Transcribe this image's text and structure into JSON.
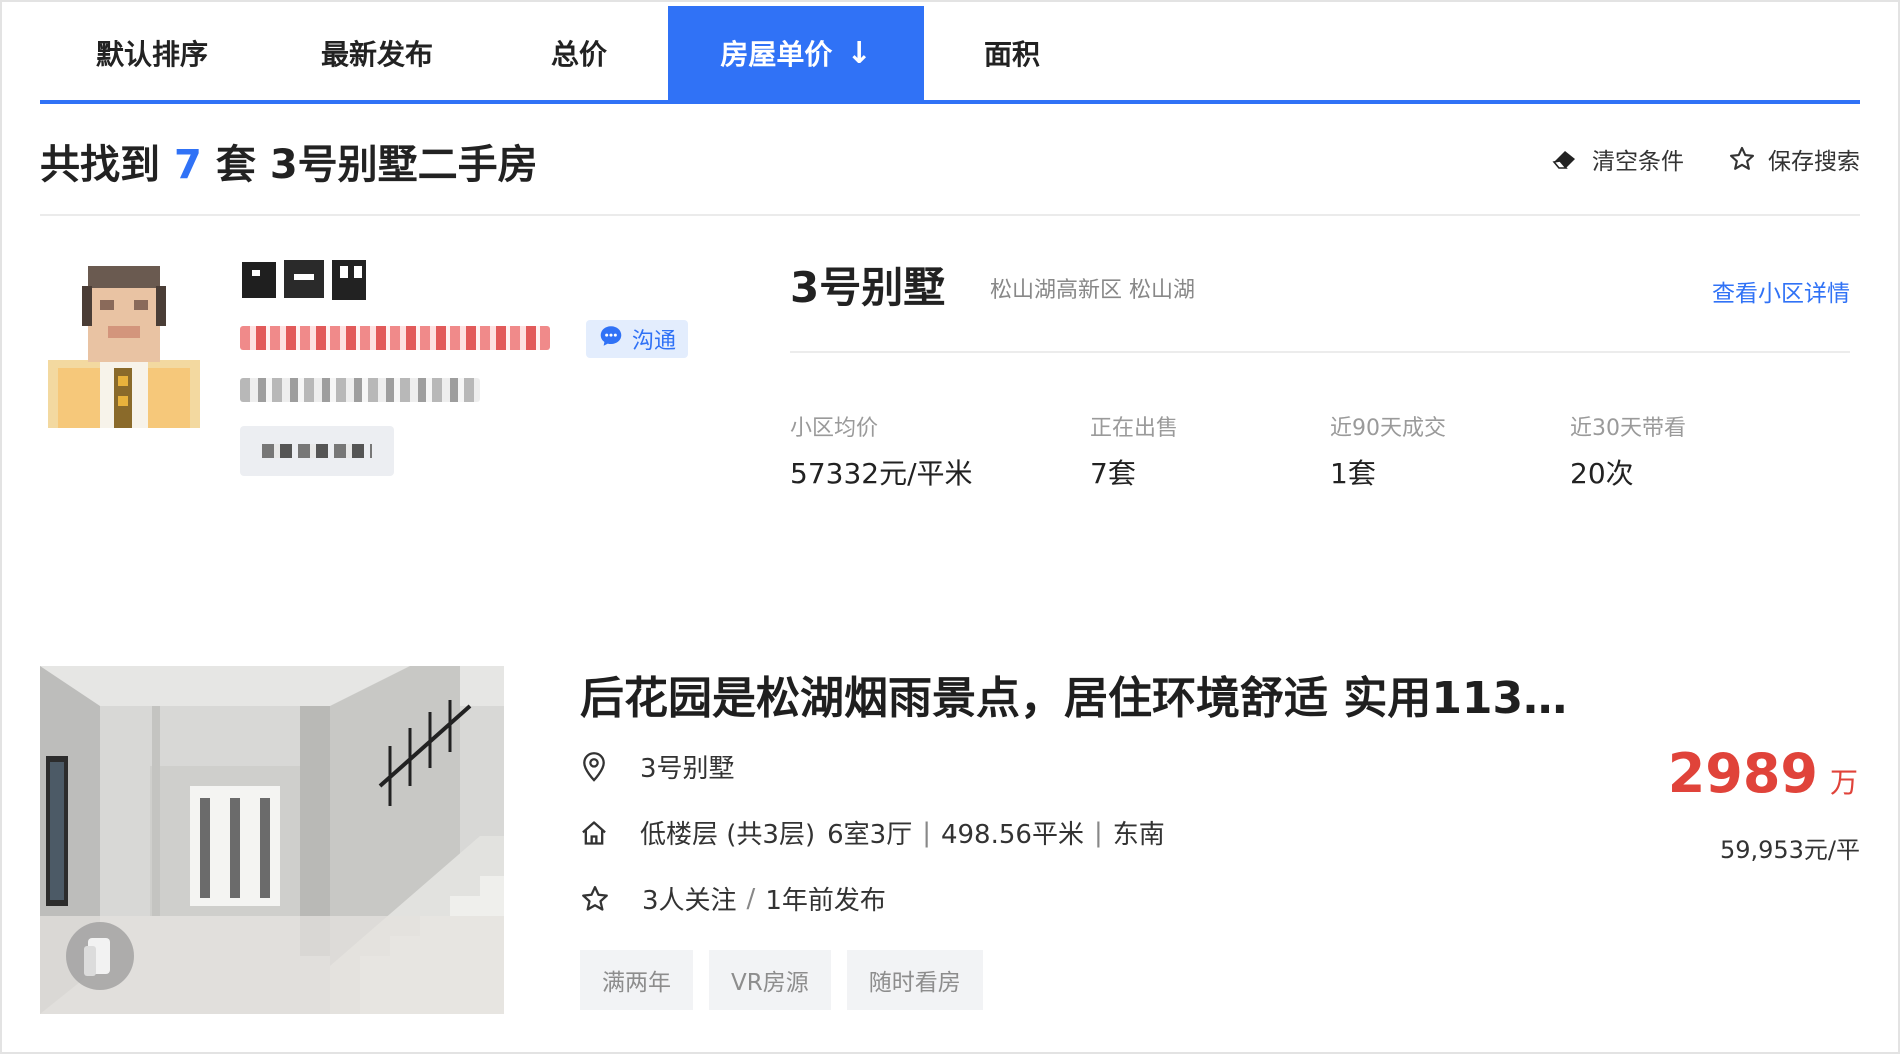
{
  "sort_tabs": [
    {
      "label": "默认排序",
      "active": false
    },
    {
      "label": "最新发布",
      "active": false
    },
    {
      "label": "总价",
      "active": false
    },
    {
      "label": "房屋单价",
      "active": true,
      "sort": "descending"
    },
    {
      "label": "面积",
      "active": false
    }
  ],
  "result": {
    "prefix": "共找到",
    "count": "7",
    "suffix": "套",
    "query": "3号别墅二手房"
  },
  "actions": {
    "clear_label": "清空条件",
    "save_label": "保存搜索"
  },
  "agent": {
    "chat_label": "沟通",
    "chat_icon": "chat-bubble-icon"
  },
  "community": {
    "name": "3号别墅",
    "area": "松山湖高新区 松山湖",
    "detail_link": "查看小区详情",
    "stats": [
      {
        "label": "小区均价",
        "value": "57332元/平米"
      },
      {
        "label": "正在出售",
        "value": "7套"
      },
      {
        "label": "近90天成交",
        "value": "1套"
      },
      {
        "label": "近30天带看",
        "value": "20次"
      }
    ]
  },
  "listing": {
    "title": "后花园是松湖烟雨景点，居住环境舒适 实用113…",
    "community": "3号别墅",
    "floor": "低楼层 (共3层)",
    "layout": "6室3厅",
    "size": "498.56平米",
    "orientation": "东南",
    "followers": "3人关注",
    "published": "1年前发布",
    "tags": [
      "满两年",
      "VR房源",
      "随时看房"
    ],
    "total_price": "2989",
    "price_unit": "万",
    "unit_price": "59,953元/平"
  },
  "colors": {
    "accent": "#3072f6",
    "price": "#e0433a"
  }
}
